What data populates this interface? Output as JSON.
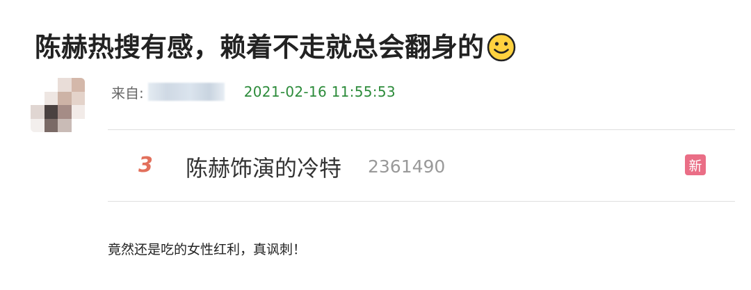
{
  "headline": {
    "text": "陈赫热搜有感，赖着不走就总会翻身的",
    "emoji": "smile-icon"
  },
  "post": {
    "from_label": "来自:",
    "timestamp": "2021-02-16 11:55:53"
  },
  "hot_search": {
    "rank": "3",
    "topic": "陈赫饰演的冷特",
    "heat": "2361490",
    "badge": "新",
    "badge_color": "#ea6e86",
    "rank_color": "#e2705c"
  },
  "comment": "竟然还是吃的女性红利，真讽刺！",
  "colors": {
    "timestamp": "#2c8b3a"
  }
}
